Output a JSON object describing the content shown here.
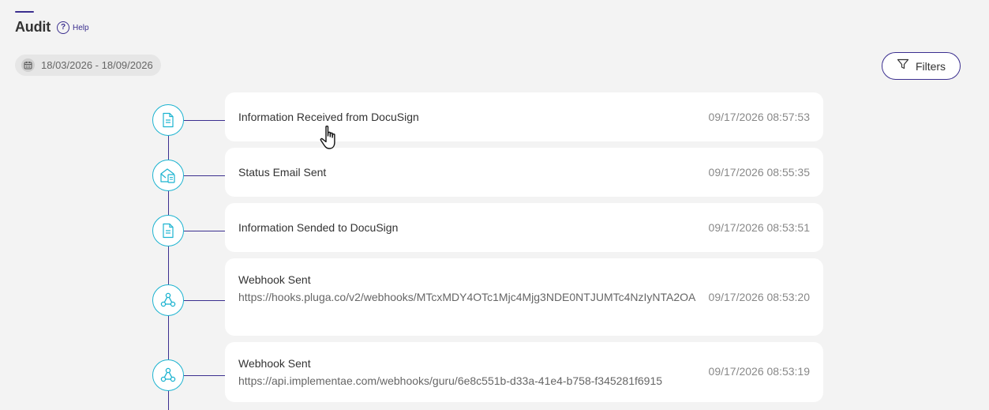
{
  "header": {
    "title": "Audit",
    "help_label": "Help"
  },
  "date_range": "18/03/2026 - 18/09/2026",
  "filters_label": "Filters",
  "accent_color": "#3b2f8f",
  "node_color": "#1bb3d0",
  "events": [
    {
      "icon": "document-icon",
      "title": "Information Received from DocuSign",
      "url": "",
      "timestamp": "09/17/2026 08:57:53"
    },
    {
      "icon": "email-open-icon",
      "title": "Status Email Sent",
      "url": "",
      "timestamp": "09/17/2026 08:55:35"
    },
    {
      "icon": "document-icon",
      "title": "Information Sended to DocuSign",
      "url": "",
      "timestamp": "09/17/2026 08:53:51"
    },
    {
      "icon": "webhook-icon",
      "title": "Webhook Sent",
      "url": "https://hooks.pluga.co/v2/webhooks/MTcxMDY4OTc1Mjc4Mjg3NDE0NTJUMTc4NzIyNTA2OA",
      "timestamp": "09/17/2026 08:53:20"
    },
    {
      "icon": "webhook-icon",
      "title": "Webhook Sent",
      "url": "https://api.implementae.com/webhooks/guru/6e8c551b-d33a-41e4-b758-f345281f6915",
      "timestamp": "09/17/2026 08:53:19"
    }
  ]
}
